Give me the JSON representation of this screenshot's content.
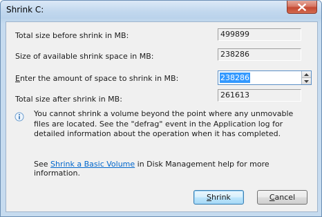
{
  "window": {
    "title": "Shrink C:",
    "close_tooltip": "Close"
  },
  "fields": {
    "total_size_before": {
      "label": "Total size before shrink in MB:",
      "value": "499899"
    },
    "available_shrink": {
      "label": "Size of available shrink space in MB:",
      "value": "238286"
    },
    "enter_amount": {
      "label_accel": "E",
      "label_rest": "nter the amount of space to shrink in MB:",
      "value": "238286"
    },
    "total_size_after": {
      "label": "Total size after shrink in MB:",
      "value": "261613"
    }
  },
  "info": {
    "icon": "info-icon",
    "text": "You cannot shrink a volume beyond the point where any unmovable files are located. See the \"defrag\" event in the Application log for detailed information about the operation when it has completed."
  },
  "help": {
    "prefix": "See ",
    "link_text": "Shrink a Basic Volume",
    "suffix": " in Disk Management help for more information."
  },
  "buttons": {
    "shrink_accel": "S",
    "shrink_rest": "hrink",
    "cancel_pre": "",
    "cancel_accel": "C",
    "cancel_rest": "ancel"
  },
  "colors": {
    "selection": "#3399ff",
    "link": "#0066cc",
    "close_button": "#c44a33"
  }
}
